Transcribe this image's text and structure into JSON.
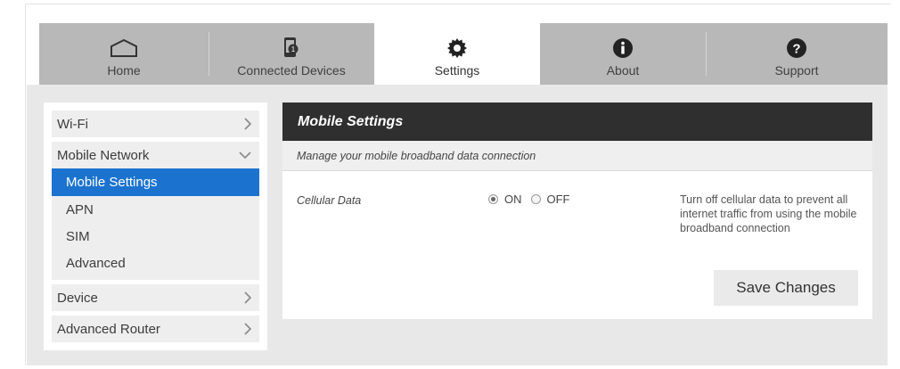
{
  "nav": {
    "tabs": [
      {
        "label": "Home",
        "icon": "home-icon"
      },
      {
        "label": "Connected Devices",
        "icon": "connected-devices-icon"
      },
      {
        "label": "Settings",
        "icon": "gear-icon",
        "active": true
      },
      {
        "label": "About",
        "icon": "info-icon"
      },
      {
        "label": "Support",
        "icon": "question-icon"
      }
    ]
  },
  "sidebar": {
    "items": [
      {
        "label": "Wi-Fi",
        "icon": "chevron-right-icon"
      },
      {
        "label": "Mobile Network",
        "icon": "chevron-down-icon",
        "expanded": true
      },
      {
        "label": "Device",
        "icon": "chevron-right-icon"
      },
      {
        "label": "Advanced Router",
        "icon": "chevron-right-icon"
      }
    ],
    "mobile_network_sub": [
      "Mobile Settings",
      "APN",
      "SIM",
      "Advanced"
    ],
    "active_sub": "Mobile Settings"
  },
  "panel": {
    "title": "Mobile Settings",
    "subtitle": "Manage your mobile broadband data connection",
    "cellular": {
      "label": "Cellular Data",
      "on_label": "ON",
      "off_label": "OFF",
      "selected": "ON",
      "help": "Turn off cellular data to prevent all internet traffic from using the mobile broadband connection"
    },
    "save_label": "Save Changes"
  },
  "colors": {
    "nav_bg": "#b8b8b8",
    "active_blue": "#1c73cf",
    "panel_header": "#2f2f2f",
    "content_bg": "#e8e8e8"
  }
}
